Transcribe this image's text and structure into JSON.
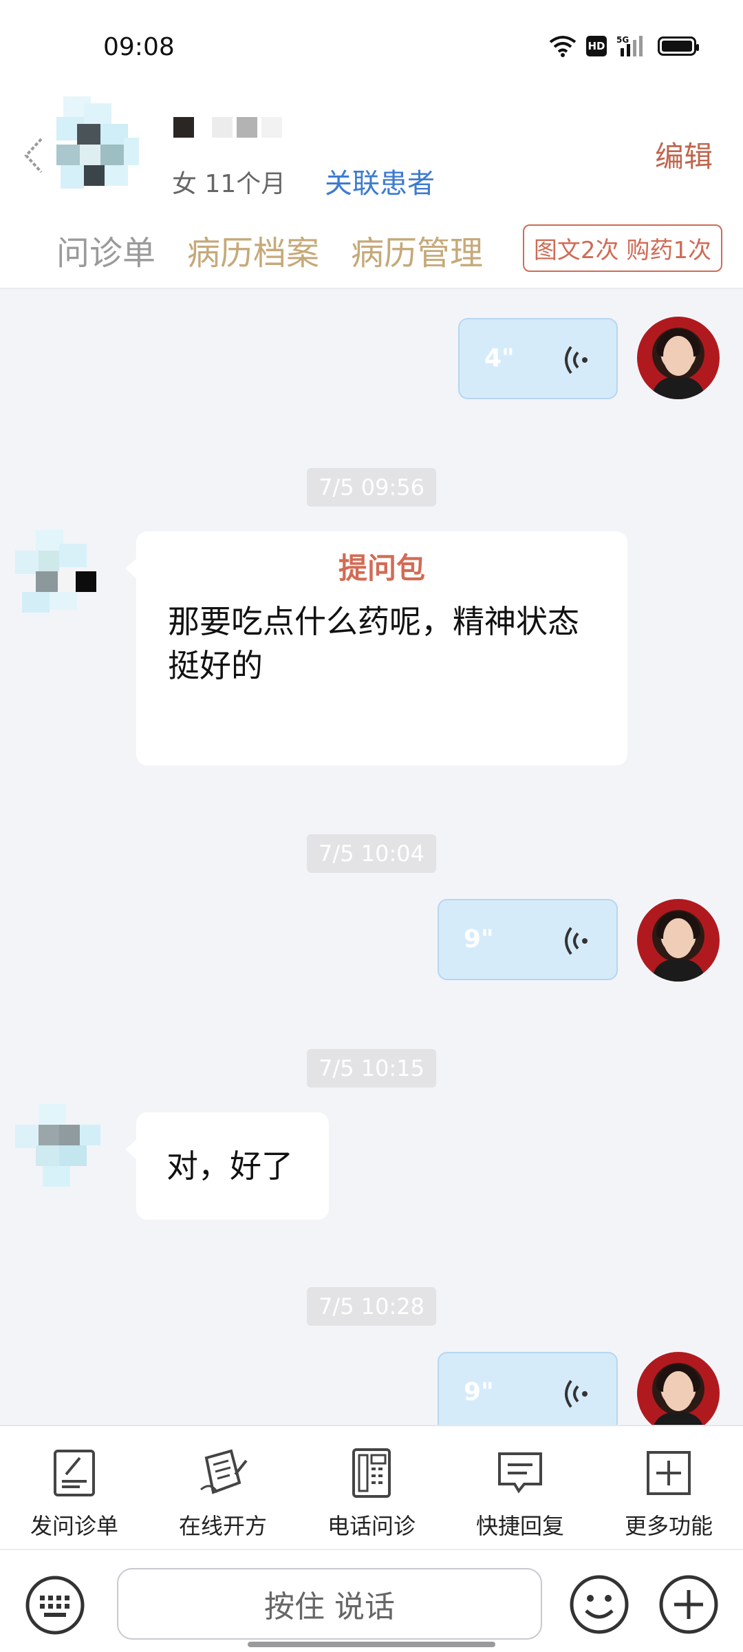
{
  "status_bar": {
    "time": "09:08",
    "hd_label": "HD",
    "network": "5G"
  },
  "header": {
    "patient_meta": "女 11个月",
    "link_patient": "关联患者",
    "edit": "编辑",
    "tabs": [
      {
        "label": "问诊单"
      },
      {
        "label": "病历档案"
      },
      {
        "label": "病历管理"
      }
    ],
    "service_tag": "图文2次 购药1次"
  },
  "messages": [
    {
      "type": "voice",
      "from": "doctor",
      "duration": "4\""
    },
    {
      "type": "timestamp",
      "text": "7/5 09:56"
    },
    {
      "type": "question_pack",
      "from": "patient",
      "title": "提问包",
      "text": "那要吃点什么药呢，精神状态挺好的"
    },
    {
      "type": "timestamp",
      "text": "7/5 10:04"
    },
    {
      "type": "voice",
      "from": "doctor",
      "duration": "9\""
    },
    {
      "type": "timestamp",
      "text": "7/5 10:15"
    },
    {
      "type": "text",
      "from": "patient",
      "text": "对，好了"
    },
    {
      "type": "timestamp",
      "text": "7/5 10:28"
    },
    {
      "type": "voice",
      "from": "doctor",
      "duration": "9\""
    }
  ],
  "toolbar": [
    {
      "label": "发问诊单",
      "icon": "form-icon"
    },
    {
      "label": "在线开方",
      "icon": "prescription-icon"
    },
    {
      "label": "电话问诊",
      "icon": "phone-icon"
    },
    {
      "label": "快捷回复",
      "icon": "quick-reply-icon"
    },
    {
      "label": "更多功能",
      "icon": "more-icon"
    }
  ],
  "input_bar": {
    "hold_to_talk": "按住 说话"
  },
  "colors": {
    "accent_red": "#cf6b55",
    "link_blue": "#3d7bd0",
    "tab_gold": "#c6a97a",
    "voice_bubble": "#d6ebfa"
  }
}
